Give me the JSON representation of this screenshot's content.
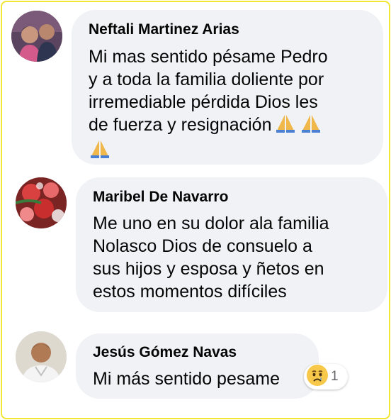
{
  "comments": [
    {
      "author": "Neftali Martinez Arias",
      "lines": [
        "Mi mas sentido pésame Pedro",
        "y a toda la familia doliente por",
        "irremediable pérdida Dios les",
        "de fuerza y resignación"
      ],
      "emojis": [
        "folded-hands",
        "folded-hands",
        "folded-hands"
      ]
    },
    {
      "author": "Maribel De Navarro",
      "lines": [
        "Me uno en su dolor ala familia",
        "Nolasco Dios de consuelo a",
        "sus hijos y esposa y ñetos en",
        "estos momentos difíciles"
      ]
    },
    {
      "author": "Jesús Gómez Navas",
      "lines": [
        "Mi más sentido pesame"
      ],
      "reaction": {
        "icon": "sad-reaction",
        "count": "1"
      }
    }
  ],
  "colors": {
    "bubble": "#f0f2f5",
    "frame": "#f2e832",
    "text": "#050505",
    "meta": "#65676b"
  }
}
